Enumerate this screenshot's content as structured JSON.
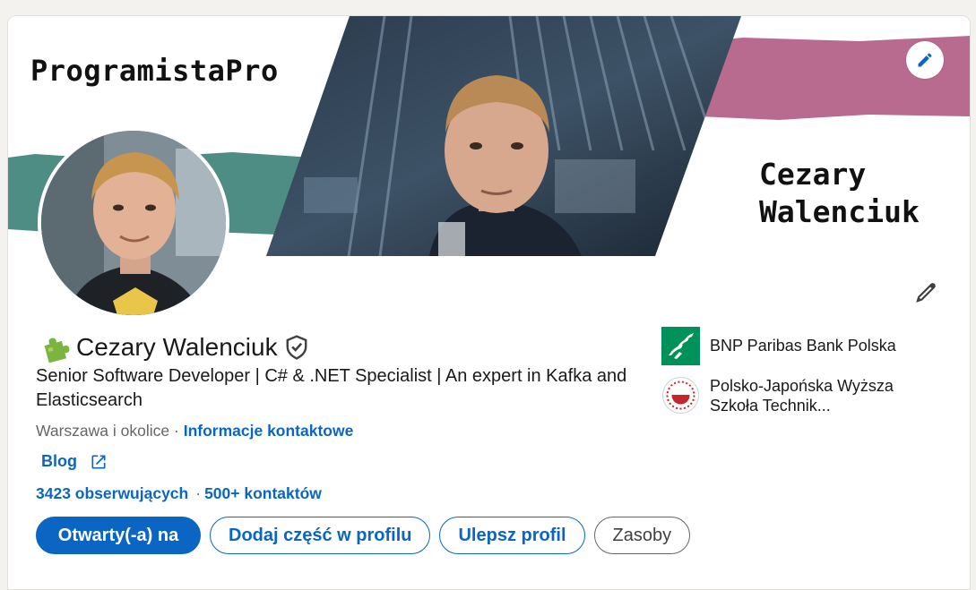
{
  "banner": {
    "brand": "ProgramistaPro",
    "name_line1": "Cezary",
    "name_line2": "Walenciuk",
    "colors": {
      "teal": "#4d8d84",
      "pink": "#b86b8e",
      "dark": "#1c2a38"
    }
  },
  "profile": {
    "badge_icon": "puzzle-icon",
    "name": "Cezary Walenciuk",
    "verified_icon": "verified-shield-icon",
    "headline": "Senior Software Developer | C# & .NET Specialist | An expert in Kafka and Elasticsearch",
    "location": "Warszawa i okolice",
    "location_separator": "·",
    "contact_link": "Informacje kontaktowe",
    "website_label": "Blog",
    "followers": "3423 obserwujących",
    "stats_separator": "·",
    "connections": "500+ kontaktów"
  },
  "orgs": [
    {
      "name": "BNP Paribas Bank Polska",
      "logo_icon": "bnp-paribas-logo"
    },
    {
      "name": "Polsko-Japońska Wyższa Szkoła Technik...",
      "logo_icon": "pjatk-logo"
    }
  ],
  "actions": {
    "open_to": "Otwarty(-a) na",
    "add_section": "Dodaj część w profilu",
    "enhance": "Ulepsz profil",
    "resources": "Zasoby"
  },
  "colors": {
    "accent": "#0a66c2",
    "text": "#191919",
    "muted": "#666666"
  }
}
